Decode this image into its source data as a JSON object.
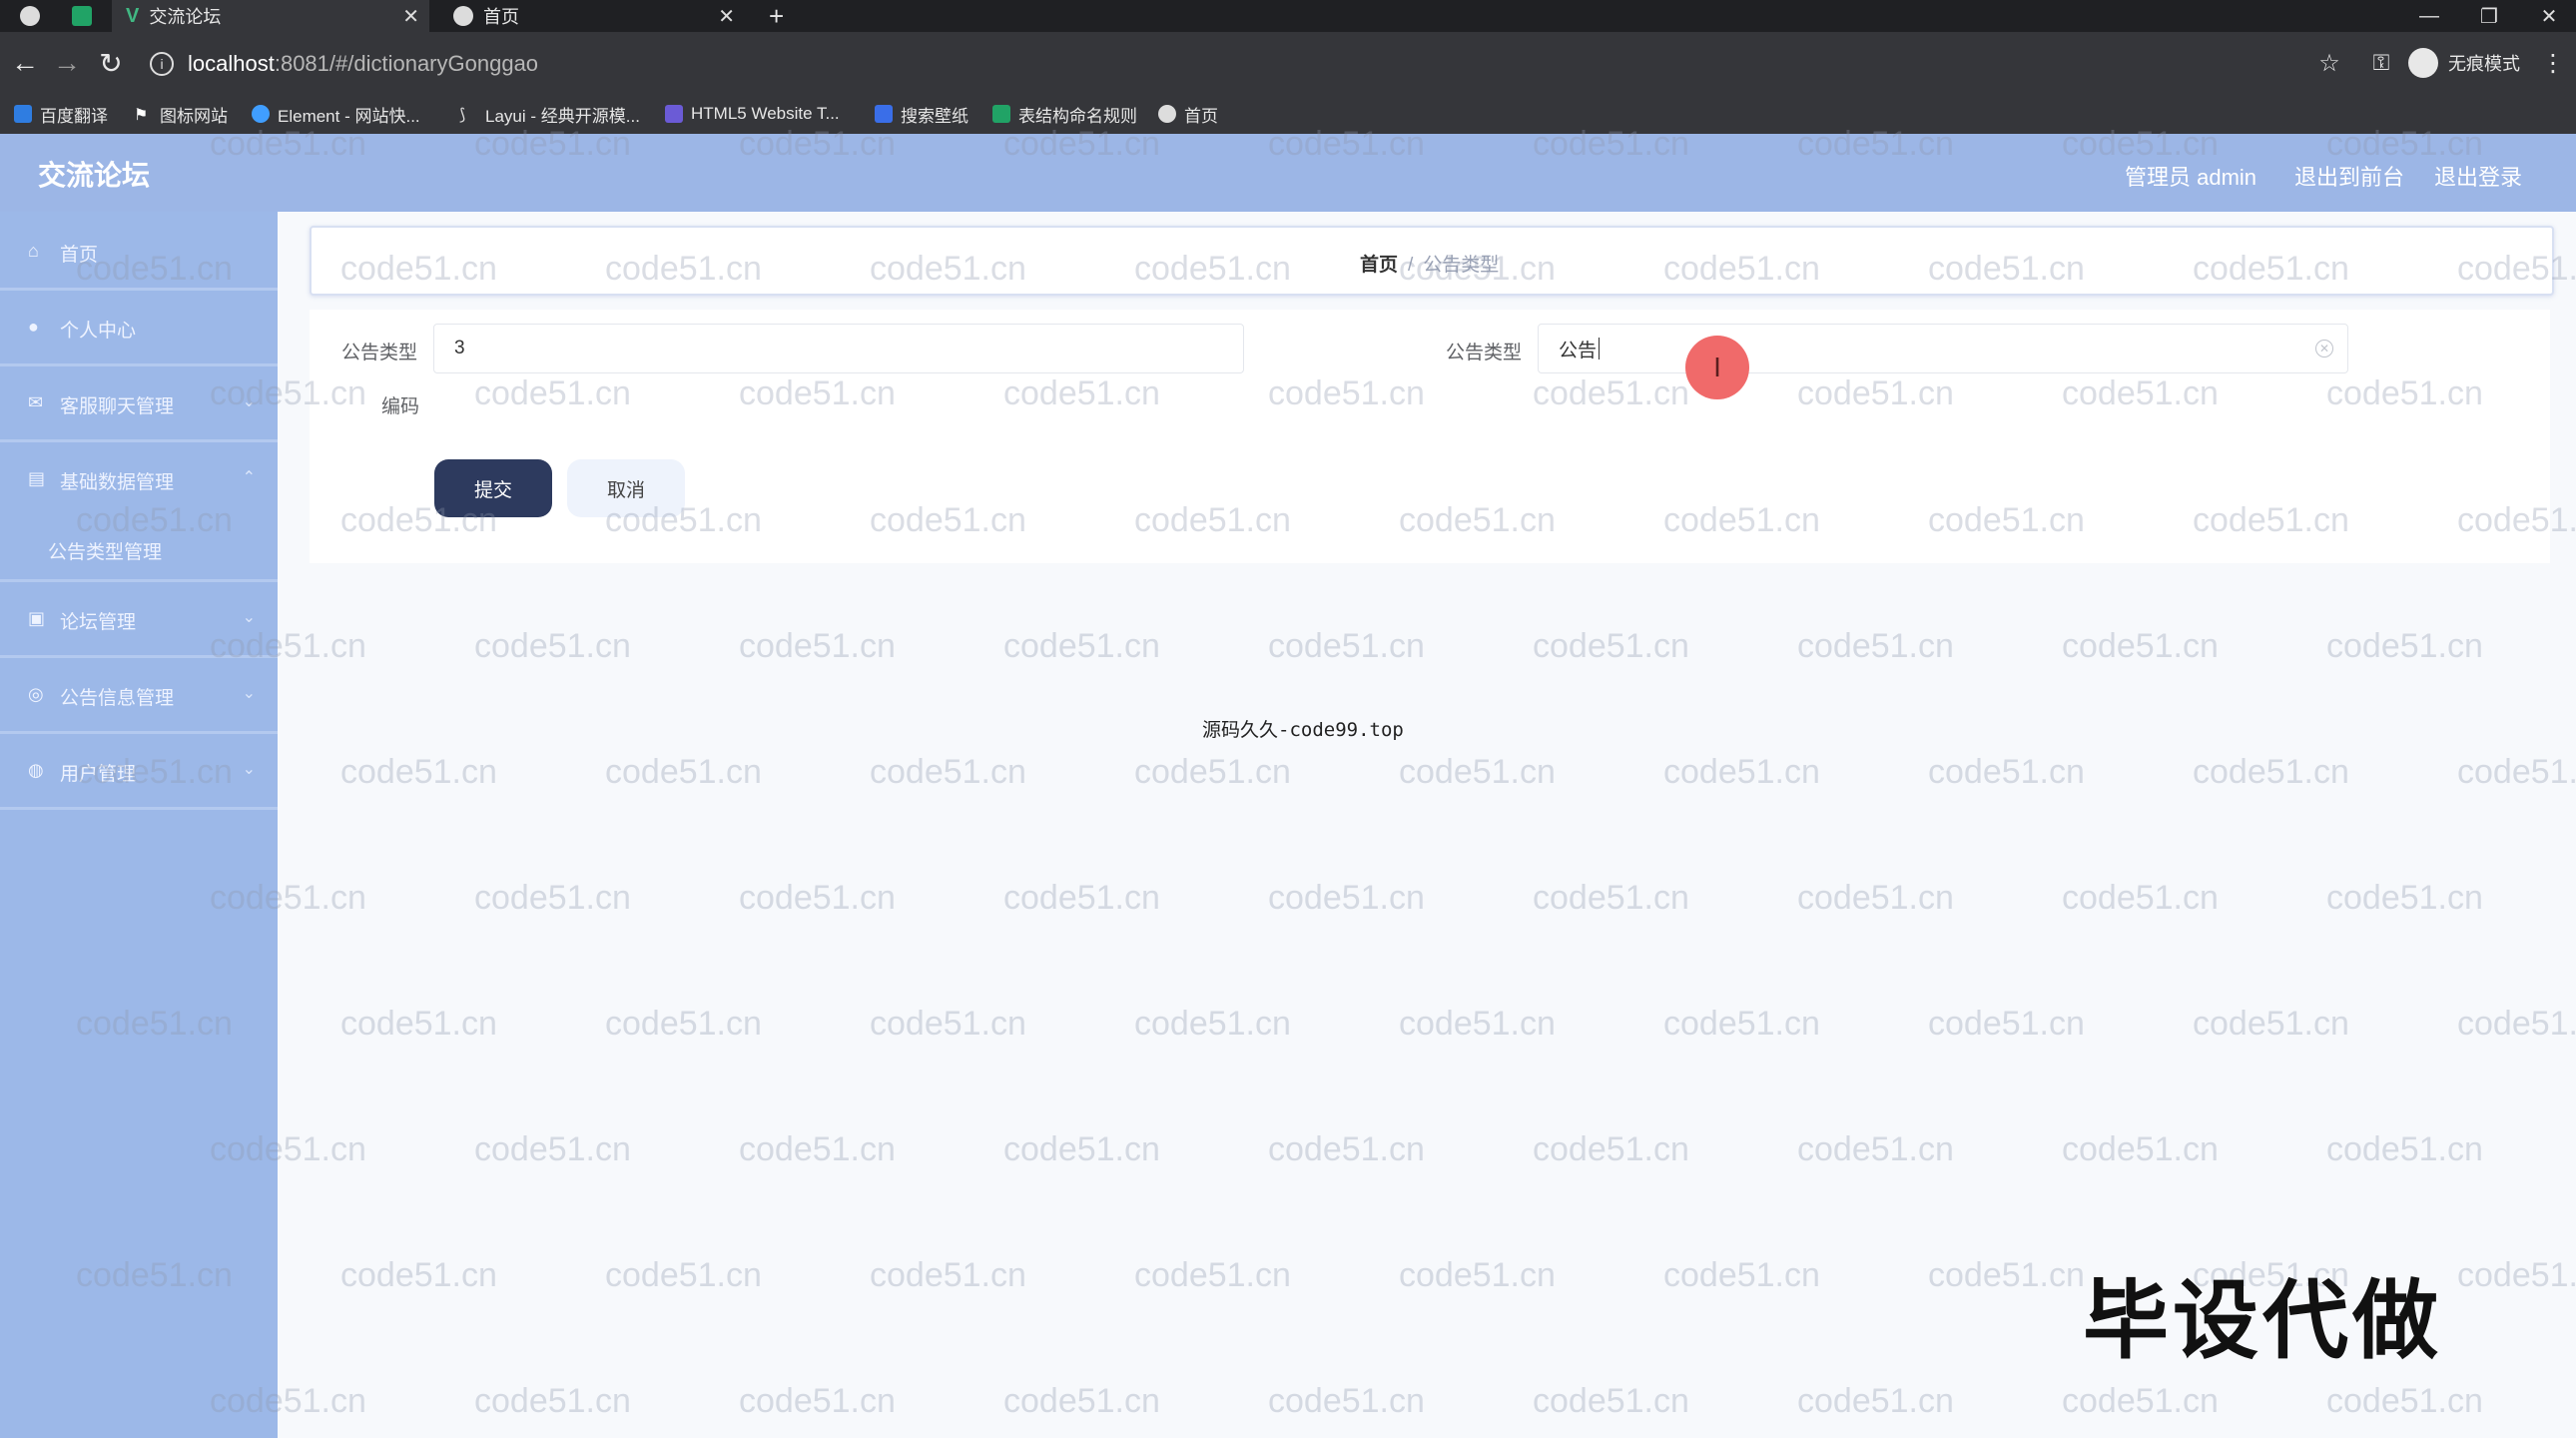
{
  "browser": {
    "tabs": [
      {
        "title": "交流论坛",
        "active": true
      },
      {
        "title": "首页",
        "active": false
      }
    ],
    "new_tab": "+",
    "url_host": "localhost",
    "url_path": ":8081/#/dictionaryGonggao",
    "incognito_label": "无痕模式",
    "bookmarks": [
      {
        "label": "百度翻译",
        "icon": "baidu-translate-icon",
        "color": "#2f7de1"
      },
      {
        "label": "图标网站",
        "icon": "flag-icon",
        "color": "#ffffff"
      },
      {
        "label": "Element - 网站快...",
        "icon": "element-icon",
        "color": "#409eff"
      },
      {
        "label": "Layui - 经典开源模...",
        "icon": "layui-icon",
        "color": "#dddddd"
      },
      {
        "label": "HTML5 Website T...",
        "icon": "html5-icon",
        "color": "#6b5bd6"
      },
      {
        "label": "搜索壁纸",
        "icon": "wallpaper-icon",
        "color": "#3a6ee8"
      },
      {
        "label": "表结构命名规则",
        "icon": "sheet-icon",
        "color": "#21a366"
      },
      {
        "label": "首页",
        "icon": "globe-icon",
        "color": "#dddddd"
      }
    ]
  },
  "header": {
    "title": "交流论坛",
    "admin_label": "管理员 admin",
    "back_to_front": "退出到前台",
    "logout": "退出登录"
  },
  "sidebar": {
    "items": [
      {
        "label": "首页",
        "icon": "home-icon"
      },
      {
        "label": "个人中心",
        "icon": "user-icon"
      },
      {
        "label": "客服聊天管理",
        "icon": "chat-icon"
      },
      {
        "label": "基础数据管理",
        "icon": "database-icon",
        "submenu": [
          "公告类型管理"
        ]
      },
      {
        "label": "论坛管理",
        "icon": "forum-icon"
      },
      {
        "label": "公告信息管理",
        "icon": "notice-icon"
      },
      {
        "label": "用户管理",
        "icon": "users-icon"
      }
    ]
  },
  "breadcrumb": {
    "home": "首页",
    "separator": "/",
    "current": "公告类型"
  },
  "form": {
    "code_label_line1": "公告类型",
    "code_label_line2": "编码",
    "code_value": "3",
    "name_label": "公告类型",
    "name_value": "公告",
    "submit": "提交",
    "cancel": "取消"
  },
  "footer_text": "源码久久-code99.top",
  "overlay_text": "毕设代做",
  "watermark_text": "code51.cn",
  "colors": {
    "header_bg": "#9cb6e6",
    "sidebar_bg": "#9cb8e8",
    "submit_bg": "#2d3a5e",
    "cursor_dot": "#f06a6a"
  }
}
